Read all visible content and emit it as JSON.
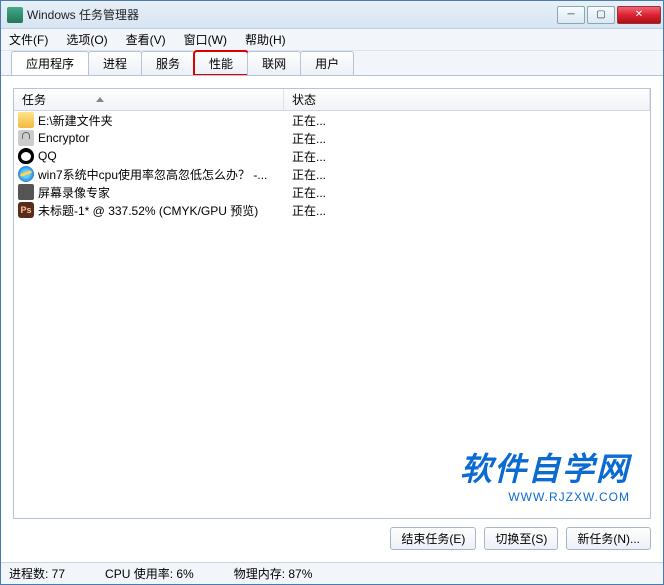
{
  "window": {
    "title": "Windows 任务管理器"
  },
  "menu": {
    "file": "文件(F)",
    "options": "选项(O)",
    "view": "查看(V)",
    "windows": "窗口(W)",
    "help": "帮助(H)"
  },
  "tabs": {
    "apps": "应用程序",
    "processes": "进程",
    "services": "服务",
    "performance": "性能",
    "networking": "联网",
    "users": "用户"
  },
  "columns": {
    "task": "任务",
    "status": "状态"
  },
  "rows": [
    {
      "icon": "folder",
      "name": "E:\\新建文件夹",
      "status": "正在..."
    },
    {
      "icon": "lock",
      "name": "Encryptor",
      "status": "正在..."
    },
    {
      "icon": "penguin",
      "name": "QQ",
      "status": "正在..."
    },
    {
      "icon": "ie",
      "name": "win7系统中cpu使用率忽高忽低怎么办？ -...",
      "status": "正在..."
    },
    {
      "icon": "vid",
      "name": "屏幕录像专家",
      "status": "正在..."
    },
    {
      "icon": "ps",
      "name": "未标题-1* @ 337.52% (CMYK/GPU 预览)",
      "status": "正在..."
    }
  ],
  "buttons": {
    "end_task": "结束任务(E)",
    "switch_to": "切换至(S)",
    "new_task": "新任务(N)..."
  },
  "statusbar": {
    "processes": "进程数: 77",
    "cpu": "CPU 使用率: 6%",
    "memory": "物理内存: 87%"
  },
  "watermark": {
    "big": "软件自学网",
    "small": "WWW.RJZXW.COM"
  }
}
